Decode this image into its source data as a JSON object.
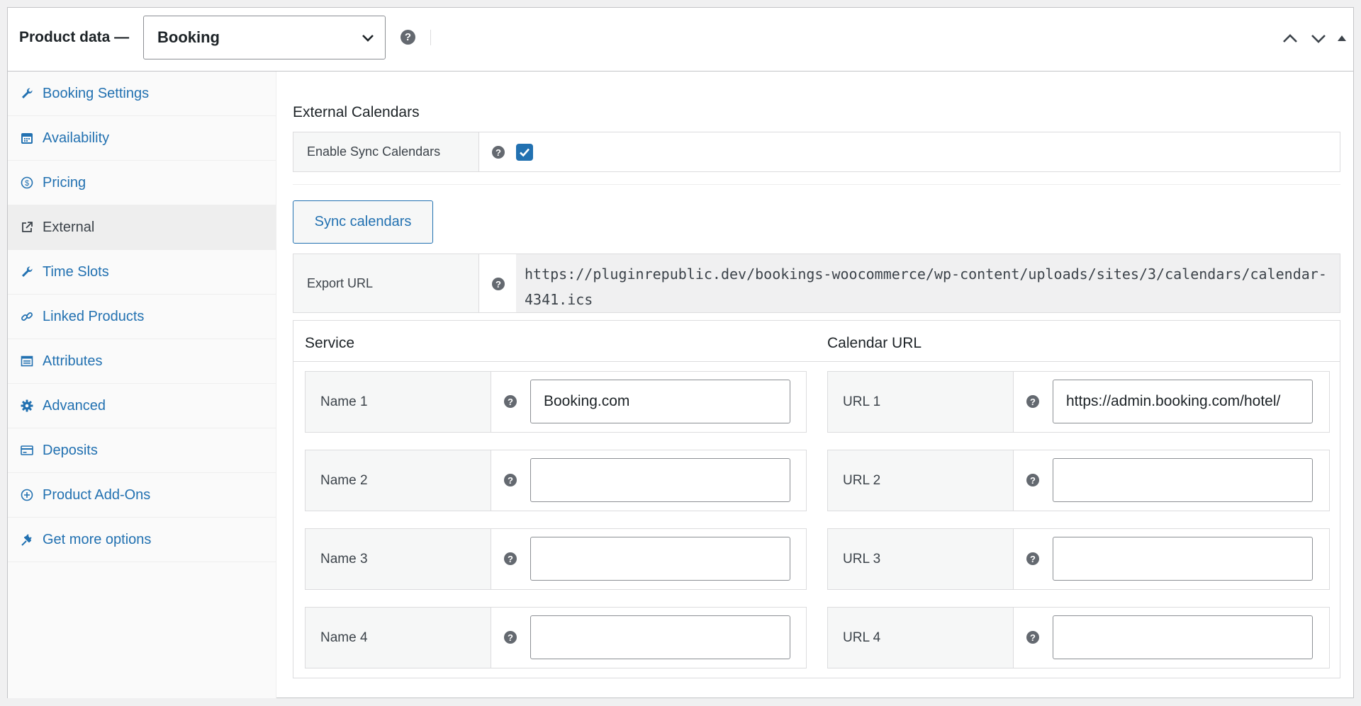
{
  "header": {
    "title": "Product data —",
    "product_type": "Booking",
    "help_glyph": "?",
    "controls": [
      "move-up-icon",
      "move-down-icon",
      "collapse-icon"
    ]
  },
  "sidebar": {
    "items": [
      {
        "label": "Booking Settings",
        "icon": "wrench-icon"
      },
      {
        "label": "Availability",
        "icon": "calendar-icon"
      },
      {
        "label": "Pricing",
        "icon": "dollar-icon"
      },
      {
        "label": "External",
        "icon": "external-link-icon",
        "active": true
      },
      {
        "label": "Time Slots",
        "icon": "wrench-icon"
      },
      {
        "label": "Linked Products",
        "icon": "link-icon"
      },
      {
        "label": "Attributes",
        "icon": "list-icon"
      },
      {
        "label": "Advanced",
        "icon": "gear-icon"
      },
      {
        "label": "Deposits",
        "icon": "card-icon"
      },
      {
        "label": "Product Add-Ons",
        "icon": "plus-circle-icon"
      },
      {
        "label": "Get more options",
        "icon": "plugin-icon"
      }
    ]
  },
  "main": {
    "section_title": "External Calendars",
    "enable_sync": {
      "label": "Enable Sync Calendars",
      "checked": true
    },
    "sync_button": "Sync calendars",
    "export": {
      "label": "Export URL",
      "value": "https://pluginrepublic.dev/bookings-woocommerce/wp-content/uploads/sites/3/calendars/calendar-4341.ics"
    },
    "table": {
      "service_header": "Service",
      "calendar_header": "Calendar URL",
      "names": [
        {
          "label": "Name 1",
          "value": "Booking.com"
        },
        {
          "label": "Name 2",
          "value": ""
        },
        {
          "label": "Name 3",
          "value": ""
        },
        {
          "label": "Name 4",
          "value": ""
        }
      ],
      "urls": [
        {
          "label": "URL 1",
          "value": "https://admin.booking.com/hotel/"
        },
        {
          "label": "URL 2",
          "value": ""
        },
        {
          "label": "URL 3",
          "value": ""
        },
        {
          "label": "URL 4",
          "value": ""
        }
      ]
    }
  },
  "colors": {
    "accent": "#2271b1",
    "label_bg": "#f6f7f7",
    "border": "#dcdcde",
    "help_icon": "#646970"
  }
}
